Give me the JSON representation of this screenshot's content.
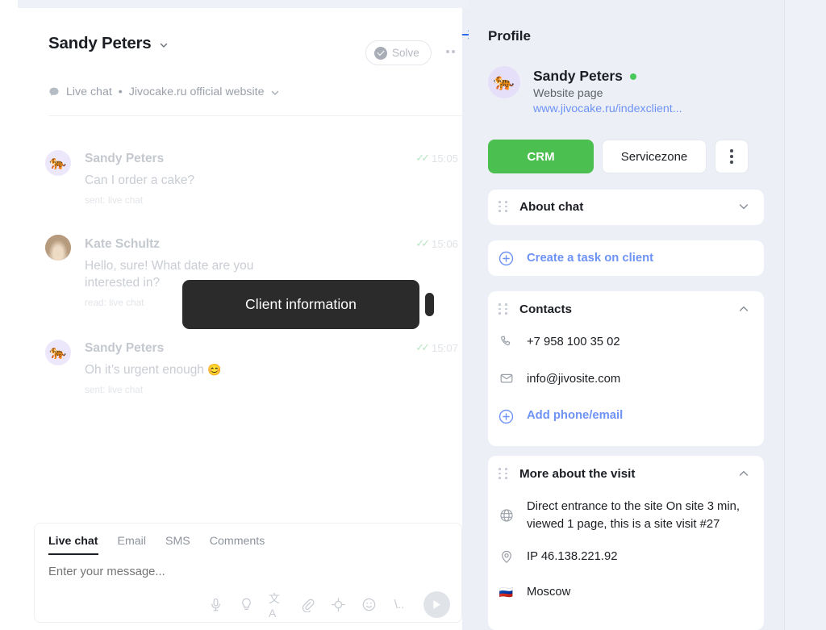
{
  "chat": {
    "header": {
      "title": "Sandy Peters",
      "dropdown_icon": "chevron-down-icon",
      "solve_label": "Solve",
      "more_icon": "more-horizontal-icon",
      "source_channel": "Live chat",
      "source_separator": "•",
      "source_site": "Jivocake.ru official website"
    },
    "messages": [
      {
        "author": "Sandy Peters",
        "avatar_emoji": "🐅",
        "text": "Can I order a cake?",
        "meta": "sent: live chat",
        "time": "15:05",
        "ticks": "✓✓"
      },
      {
        "author": "Kate Schultz",
        "avatar_emoji": "",
        "text": "Hello, sure! What date are you interested in?",
        "meta": "read: live chat",
        "time": "15:06",
        "ticks": "✓✓"
      },
      {
        "author": "Sandy Peters",
        "avatar_emoji": "🐅",
        "text": "Oh it’s urgent enough ",
        "text_emoji": "😊",
        "meta": "sent: live chat",
        "time": "15:07",
        "ticks": "✓✓"
      }
    ],
    "tooltip": {
      "label": "Client information"
    },
    "composer": {
      "tabs": [
        {
          "label": "Live chat",
          "active": true
        },
        {
          "label": "Email",
          "active": false
        },
        {
          "label": "SMS",
          "active": false
        },
        {
          "label": "Comments",
          "active": false
        }
      ],
      "placeholder": "Enter your message...",
      "value": "",
      "tools": [
        "microphone-icon",
        "lightbulb-icon",
        "translate-icon",
        "paperclip-icon",
        "crosshair-icon",
        "smiley-icon",
        "slash-command-icon"
      ],
      "translate_glyph": "文A",
      "slash_glyph": "\\..",
      "send_icon": "send-icon"
    }
  },
  "profile": {
    "back_icon": "arrow-right-icon",
    "title": "Profile",
    "client": {
      "avatar_emoji": "🐅",
      "name": "Sandy Peters",
      "status": "online",
      "status_color": "#49c85c",
      "subtitle": "Website page",
      "link": "www.jivocake.ru/indexclient..."
    },
    "actions": {
      "crm_label": "CRM",
      "crm_color": "#4bbf4f",
      "servicezone_label": "Servicezone",
      "kebab_icon": "more-vertical-icon"
    },
    "cards": [
      {
        "id": "about-chat",
        "kind": "collapsible",
        "drag_icon": "drag-handle-icon",
        "title": "About chat",
        "chevron": "chevron-down-icon",
        "expanded": false
      },
      {
        "id": "create-task",
        "kind": "link",
        "icon": "plus-circle-icon",
        "label": "Create a task on client",
        "link_color": "#6e93f5"
      },
      {
        "id": "contacts",
        "kind": "collapsible",
        "drag_icon": "drag-handle-icon",
        "title": "Contacts",
        "chevron": "chevron-up-icon",
        "expanded": true,
        "rows": [
          {
            "icon": "phone-icon",
            "text": "+7 958 100 35 02"
          },
          {
            "icon": "mail-icon",
            "text": "info@jivosite.com"
          }
        ],
        "add_link": {
          "icon": "plus-circle-icon",
          "label": "Add phone/email"
        }
      },
      {
        "id": "more-about-visit",
        "kind": "collapsible",
        "drag_icon": "drag-handle-icon",
        "title": "More about the visit",
        "chevron": "chevron-up-icon",
        "expanded": true,
        "rows": [
          {
            "icon": "globe-icon",
            "text": "Direct entrance to the site On site 3 min, viewed 1 page, this is a site visit #27"
          },
          {
            "icon": "location-pin-icon",
            "text": "IP 46.138.221.92"
          },
          {
            "icon": "flag-ru-icon",
            "flag": "🇷🇺",
            "text": "Moscow"
          }
        ]
      }
    ]
  }
}
